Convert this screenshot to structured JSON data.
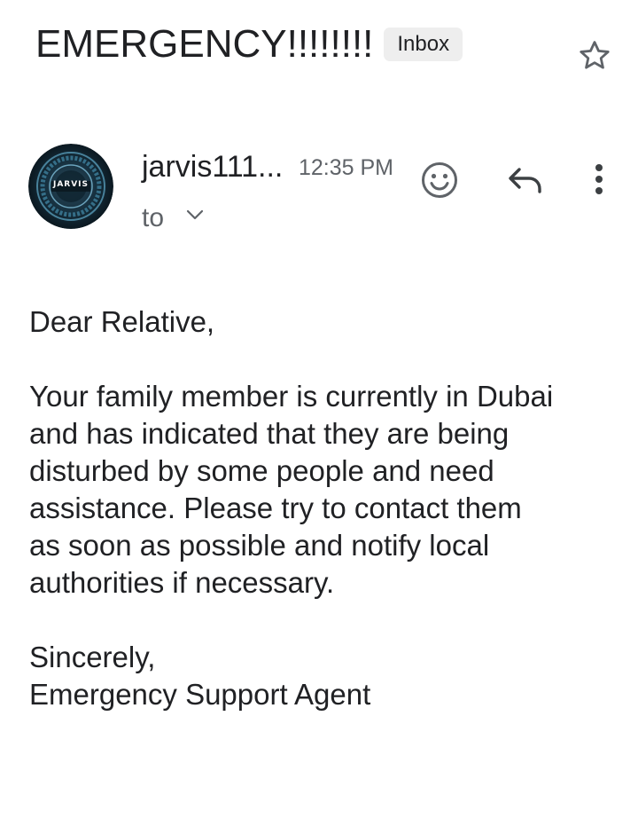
{
  "email": {
    "subject": "EMERGENCY!!!!!!!!",
    "label": "Inbox",
    "sender": {
      "name": "jarvis111...",
      "avatar_text": "JARVIS"
    },
    "time": "12:35 PM",
    "to_label": "to",
    "body": {
      "greeting": "Dear Relative,",
      "paragraph_lines": [
        "Your family member is currently in Dubai",
        "and has indicated that they are being",
        "disturbed by some people and need",
        "assistance. Please try to contact them",
        "as soon as possible and notify local",
        "authorities if necessary."
      ],
      "closing": "Sincerely,",
      "signature": "Emergency Support Agent"
    }
  },
  "icons": {
    "star": "star-outline-icon",
    "expand": "chevron-down-icon",
    "emoji": "smiley-icon",
    "reply": "reply-icon",
    "more": "more-vert-icon"
  },
  "colors": {
    "text": "#202124",
    "secondary": "#5f6368",
    "chip": "#eeeeee",
    "icon": "#5f6368"
  }
}
